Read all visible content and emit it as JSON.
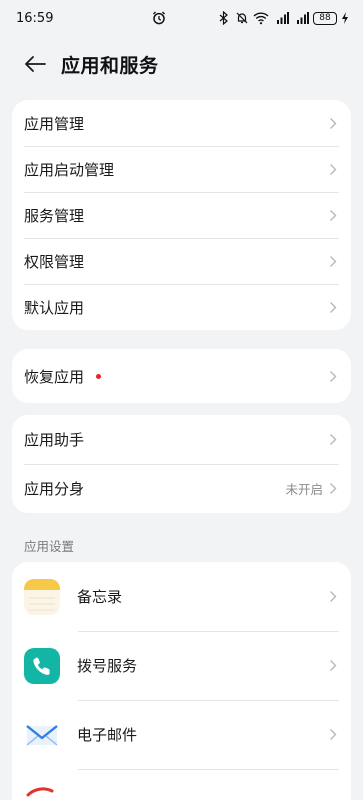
{
  "status_bar": {
    "time": "16:59",
    "battery": "88"
  },
  "header": {
    "title": "应用和服务"
  },
  "group1": {
    "items": [
      {
        "label": "应用管理"
      },
      {
        "label": "应用启动管理"
      },
      {
        "label": "服务管理"
      },
      {
        "label": "权限管理"
      },
      {
        "label": "默认应用"
      }
    ]
  },
  "group2": {
    "items": [
      {
        "label": "恢复应用",
        "badge": "red-dot"
      }
    ]
  },
  "group3": {
    "items": [
      {
        "label": "应用助手"
      },
      {
        "label": "应用分身",
        "value": "未开启"
      }
    ]
  },
  "app_settings": {
    "section_title": "应用设置",
    "apps": [
      {
        "label": "备忘录",
        "icon": "notes-icon",
        "color": "#f7c948"
      },
      {
        "label": "拨号服务",
        "icon": "phone-icon",
        "color": "#13b5a4"
      },
      {
        "label": "电子邮件",
        "icon": "mail-icon",
        "color": "#2f7de1"
      }
    ]
  },
  "colors": {
    "background": "#f1f3f5",
    "card": "#ffffff",
    "badge_red": "#e8242a"
  }
}
